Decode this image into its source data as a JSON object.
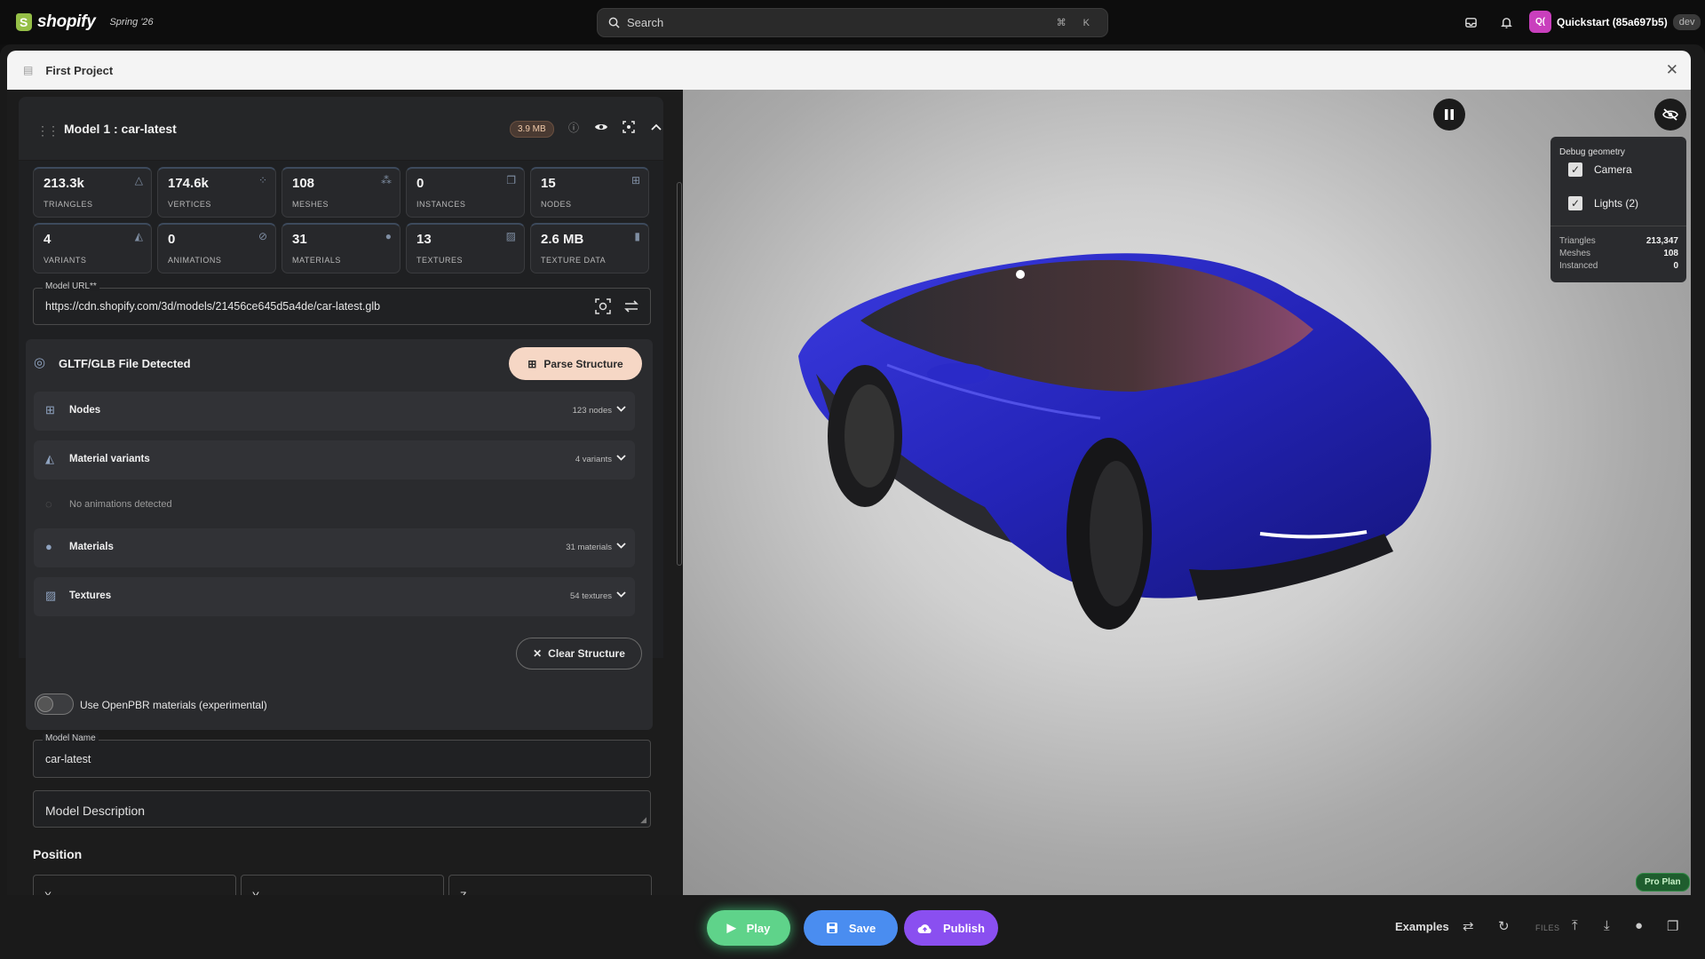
{
  "topbar": {
    "logo": "shopify",
    "version": "Spring '26",
    "search_placeholder": "Search",
    "search_shortcut": "⌘ K",
    "store_initials": "Q(",
    "store_name": "Quickstart (85a697b5)",
    "env_badge": "dev"
  },
  "window": {
    "title": "First Project"
  },
  "model": {
    "title": "Model 1 : car-latest",
    "size": "3.9 MB",
    "stats": [
      {
        "value": "213.3k",
        "label": "TRIANGLES",
        "icon": "triangle-icon"
      },
      {
        "value": "174.6k",
        "label": "VERTICES",
        "icon": "vertices-icon"
      },
      {
        "value": "108",
        "label": "MESHES",
        "icon": "meshes-icon"
      },
      {
        "value": "0",
        "label": "INSTANCES",
        "icon": "instances-icon"
      },
      {
        "value": "15",
        "label": "NODES",
        "icon": "nodes-icon"
      },
      {
        "value": "4",
        "label": "VARIANTS",
        "icon": "variants-icon"
      },
      {
        "value": "0",
        "label": "ANIMATIONS",
        "icon": "animations-icon"
      },
      {
        "value": "31",
        "label": "MATERIALS",
        "icon": "materials-icon"
      },
      {
        "value": "13",
        "label": "TEXTURES",
        "icon": "textures-icon"
      },
      {
        "value": "2.6 MB",
        "label": "TEXTURE DATA",
        "icon": "texture-data-icon"
      }
    ],
    "url_label": "Model URL**",
    "url_value": "https://cdn.shopify.com/3d/models/21456ce645d5a4de/car-latest.glb"
  },
  "gltf": {
    "title": "GLTF/GLB File Detected",
    "parse_label": "Parse Structure",
    "rows": [
      {
        "label": "Nodes",
        "count": "123 nodes"
      },
      {
        "label": "Material variants",
        "count": "4 variants"
      },
      {
        "label": "No animations detected",
        "count": ""
      },
      {
        "label": "Materials",
        "count": "31 materials"
      },
      {
        "label": "Textures",
        "count": "54 textures"
      }
    ],
    "clear_label": "Clear Structure",
    "toggle_label": "Use OpenPBR materials (experimental)"
  },
  "form": {
    "name_label": "Model Name",
    "name_value": "car-latest",
    "description_placeholder": "Model Description",
    "position_title": "Position",
    "position_fields": [
      "X",
      "Y",
      "Z"
    ]
  },
  "debug": {
    "title": "Debug geometry",
    "camera": "Camera",
    "lights": "Lights (2)",
    "stats": [
      {
        "label": "Triangles",
        "value": "213,347"
      },
      {
        "label": "Meshes",
        "value": "108"
      },
      {
        "label": "Instanced",
        "value": "0"
      }
    ]
  },
  "viewport": {
    "plan_badge": "Pro Plan",
    "car_color": "#2a2ac8"
  },
  "bottom": {
    "play": "Play",
    "save": "Save",
    "publish": "Publish",
    "examples": "Examples",
    "files": "FILES",
    "colors": {
      "play": "#5fd38a",
      "save": "#4a8df0",
      "publish": "#8a4ff0"
    }
  }
}
